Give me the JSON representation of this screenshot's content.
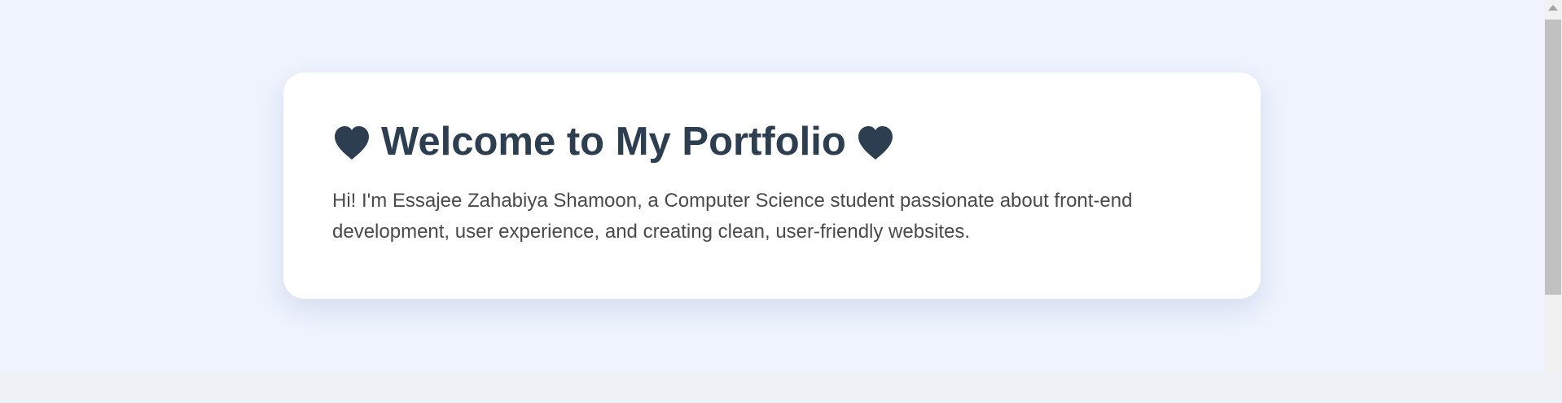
{
  "hero": {
    "title": "Welcome to My Portfolio",
    "intro": "Hi! I'm Essajee Zahabiya Shamoon, a Computer Science student passionate about front-end development, user experience, and creating clean, user-friendly websites.",
    "left_icon": "heart-icon",
    "right_icon": "heart-icon"
  },
  "colors": {
    "page_background": "#eef3fd",
    "card_background": "#ffffff",
    "title": "#2c3e50",
    "body_text": "#4a4a4a"
  }
}
